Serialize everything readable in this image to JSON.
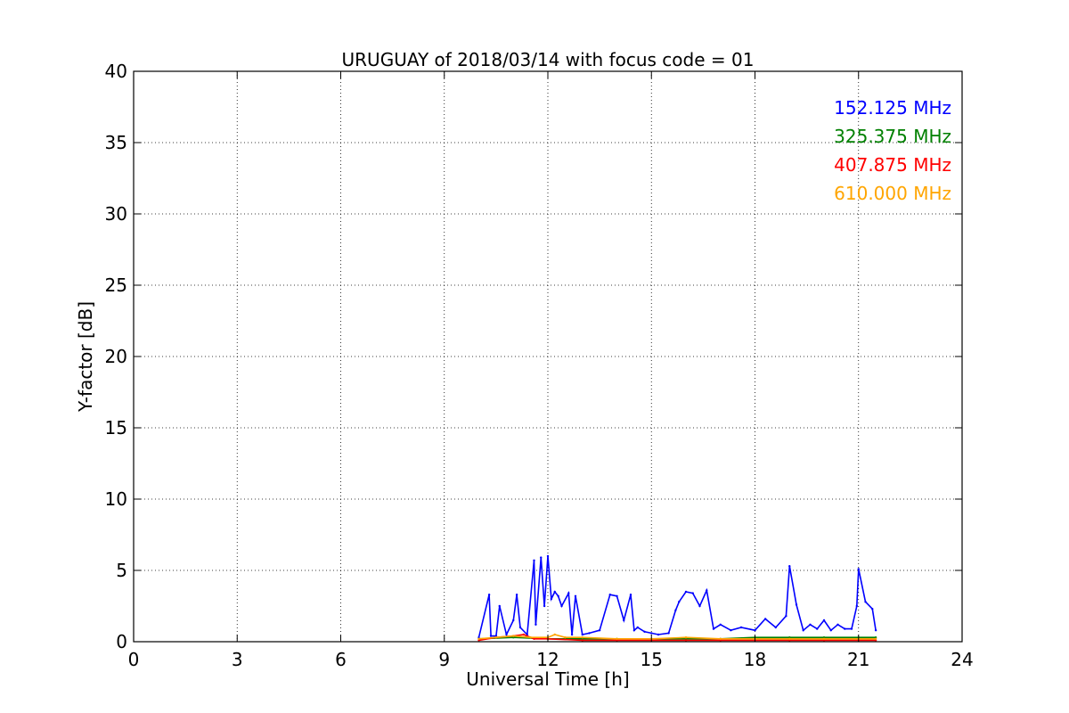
{
  "chart_data": {
    "type": "line",
    "title": "URUGUAY of 2018/03/14 with focus code = 01",
    "xlabel": "Universal Time [h]",
    "ylabel": "Y-factor [dB]",
    "xlim": [
      0,
      24
    ],
    "ylim": [
      0,
      40
    ],
    "xticks": [
      0,
      3,
      6,
      9,
      12,
      15,
      18,
      21,
      24
    ],
    "yticks": [
      0,
      5,
      10,
      15,
      20,
      25,
      30,
      35,
      40
    ],
    "grid": true,
    "legend_position": "top-right",
    "series": [
      {
        "name": "152.125 MHz",
        "color": "#0000ff",
        "x": [
          10.0,
          10.3,
          10.35,
          10.5,
          10.6,
          10.8,
          11.0,
          11.1,
          11.2,
          11.4,
          11.6,
          11.65,
          11.8,
          11.9,
          12.0,
          12.1,
          12.2,
          12.3,
          12.4,
          12.6,
          12.7,
          12.8,
          13.0,
          13.2,
          13.5,
          13.8,
          14.0,
          14.2,
          14.4,
          14.5,
          14.6,
          14.8,
          15.0,
          15.2,
          15.5,
          15.7,
          15.8,
          16.0,
          16.2,
          16.4,
          16.6,
          16.8,
          17.0,
          17.3,
          17.6,
          18.0,
          18.3,
          18.6,
          18.9,
          19.0,
          19.2,
          19.4,
          19.6,
          19.8,
          20.0,
          20.2,
          20.4,
          20.6,
          20.8,
          20.95,
          21.0,
          21.2,
          21.4,
          21.5
        ],
        "y": [
          0.3,
          3.3,
          0.4,
          0.4,
          2.5,
          0.5,
          1.5,
          3.3,
          1.0,
          0.5,
          5.7,
          1.2,
          5.9,
          2.5,
          6.0,
          3.0,
          3.5,
          3.2,
          2.5,
          3.4,
          0.5,
          3.2,
          0.5,
          0.6,
          0.8,
          3.3,
          3.2,
          1.5,
          3.3,
          0.8,
          1.0,
          0.7,
          0.6,
          0.5,
          0.6,
          2.2,
          2.8,
          3.5,
          3.4,
          2.5,
          3.6,
          0.9,
          1.2,
          0.8,
          1.0,
          0.8,
          1.6,
          1.0,
          1.8,
          5.3,
          2.6,
          0.8,
          1.2,
          0.9,
          1.5,
          0.8,
          1.2,
          0.9,
          0.9,
          2.5,
          5.1,
          2.8,
          2.3,
          0.8
        ]
      },
      {
        "name": "325.375 MHz",
        "color": "#008000",
        "x": [
          10.0,
          11.0,
          12.0,
          13.0,
          14.0,
          15.0,
          16.0,
          17.0,
          18.0,
          19.0,
          20.0,
          21.0,
          21.5
        ],
        "y": [
          0.2,
          0.3,
          0.2,
          0.2,
          0.2,
          0.2,
          0.2,
          0.2,
          0.3,
          0.3,
          0.3,
          0.3,
          0.3
        ]
      },
      {
        "name": "407.875 MHz",
        "color": "#ff0000",
        "x": [
          10.0,
          10.5,
          11.0,
          11.3,
          11.6,
          12.0,
          13.0,
          14.0,
          15.0,
          16.0,
          17.0,
          18.0,
          19.0,
          20.0,
          21.0,
          21.5
        ],
        "y": [
          0.1,
          0.3,
          0.4,
          0.5,
          0.2,
          0.2,
          0.1,
          0.1,
          0.1,
          0.1,
          0.1,
          0.1,
          0.1,
          0.1,
          0.1,
          0.1
        ]
      },
      {
        "name": "610.000 MHz",
        "color": "#ffa500",
        "x": [
          10.0,
          10.5,
          11.0,
          11.5,
          12.0,
          12.2,
          12.5,
          13.0,
          14.0,
          15.0,
          16.0,
          17.0,
          18.0,
          19.0,
          20.0,
          21.0,
          21.5
        ],
        "y": [
          0.2,
          0.3,
          0.4,
          0.3,
          0.3,
          0.5,
          0.3,
          0.3,
          0.2,
          0.2,
          0.3,
          0.2,
          0.2,
          0.2,
          0.2,
          0.2,
          0.2
        ]
      }
    ]
  }
}
